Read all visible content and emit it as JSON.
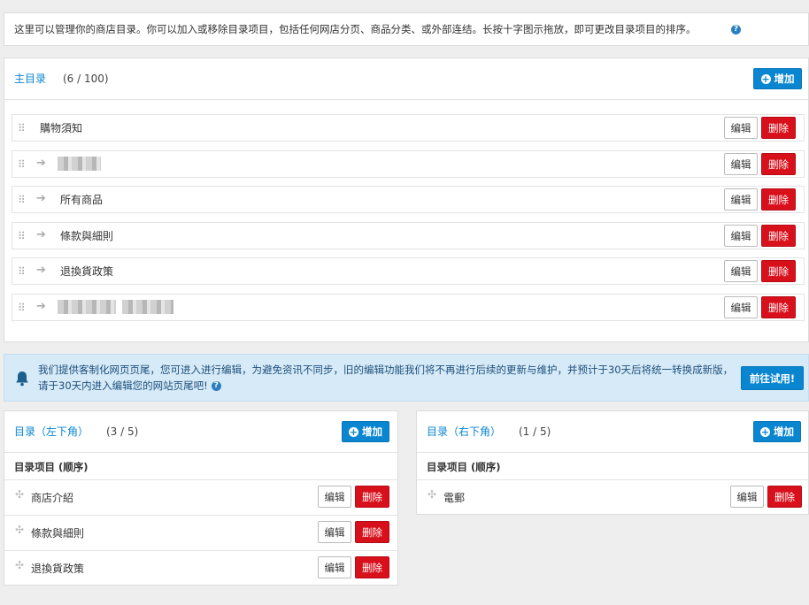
{
  "intro": {
    "text": "这里可以管理你的商店目录。你可以加入或移除目录项目，包括任何网店分页、商品分类、或外部连结。长按十字图示拖放，即可更改目录项目的排序。",
    "help_icon": "question-circle-icon"
  },
  "main_menu": {
    "title": "主目录",
    "count": "(6 / 100)",
    "add_label": "增加",
    "items": [
      {
        "label": "購物須知",
        "has_arrow": false
      },
      {
        "label": "",
        "redacted": true,
        "has_arrow": true
      },
      {
        "label": "所有商品",
        "has_arrow": true
      },
      {
        "label": "條款與細則",
        "has_arrow": true
      },
      {
        "label": "退換貨政策",
        "has_arrow": true
      },
      {
        "label": "",
        "redacted": true,
        "has_arrow": true
      }
    ]
  },
  "notice": {
    "text": "我们提供客制化网页页尾，您可进入进行编辑，为避免资讯不同步，旧的编辑功能我们将不再进行后续的更新与维护，并预计于30天后将统一转换成新版，请于30天内进入编辑您的网站页尾吧!",
    "button_label": "前往试用!",
    "icon": "bell-icon"
  },
  "footer_left": {
    "title": "目录（左下角）",
    "count": "(3 / 5)",
    "add_label": "增加",
    "col_header": "目录项目 (顺序)",
    "items": [
      {
        "label": "商店介紹"
      },
      {
        "label": "條款與細則"
      },
      {
        "label": "退換貨政策"
      }
    ]
  },
  "footer_right": {
    "title": "目录（右下角）",
    "count": "(1 / 5)",
    "add_label": "增加",
    "col_header": "目录项目 (顺序)",
    "items": [
      {
        "label": "電郵"
      }
    ]
  },
  "actions": {
    "edit": "编辑",
    "delete": "删除"
  },
  "colors": {
    "accent": "#0a86d0",
    "danger": "#d8101c",
    "notice_bg": "#d6eaf8"
  }
}
